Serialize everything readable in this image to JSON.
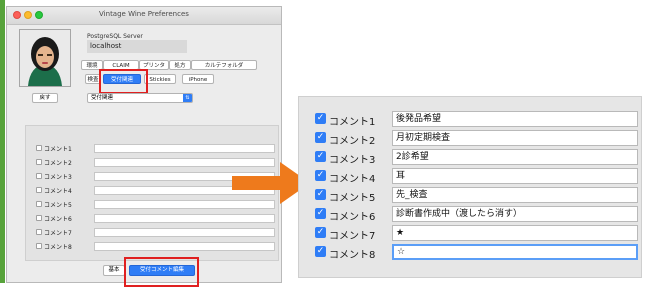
{
  "window": {
    "title": "Vintage Wine Preferences"
  },
  "server": {
    "label": "PostgreSQL Server",
    "value": "localhost"
  },
  "tabs_row1": [
    {
      "label": "環境"
    },
    {
      "label": "CLAIM"
    },
    {
      "label": "プリンタ"
    },
    {
      "label": "処方"
    },
    {
      "label": "カルテフォルダ"
    }
  ],
  "tabs_row2": [
    {
      "label": "検査"
    },
    {
      "label": "受付関連"
    },
    {
      "label": "Stickies"
    },
    {
      "label": "iPhone"
    }
  ],
  "selected_tab": "受付関連",
  "back_button": {
    "label": "戻す"
  },
  "section_select": {
    "value": "受付関連"
  },
  "small_comments": [
    {
      "label": "コメント1",
      "checked": false
    },
    {
      "label": "コメント2",
      "checked": false
    },
    {
      "label": "コメント3",
      "checked": false
    },
    {
      "label": "コメント4",
      "checked": false
    },
    {
      "label": "コメント5",
      "checked": false
    },
    {
      "label": "コメント6",
      "checked": false
    },
    {
      "label": "コメント7",
      "checked": false
    },
    {
      "label": "コメント8",
      "checked": false
    }
  ],
  "bottom_buttons": [
    {
      "label": "基本",
      "selected": false
    },
    {
      "label": "受付コメント編集",
      "selected": true
    }
  ],
  "zoom_comments": [
    {
      "label": "コメント1",
      "checked": true,
      "value": "後発品希望"
    },
    {
      "label": "コメント2",
      "checked": true,
      "value": "月初定期検査"
    },
    {
      "label": "コメント3",
      "checked": true,
      "value": "2診希望"
    },
    {
      "label": "コメント4",
      "checked": true,
      "value": "耳"
    },
    {
      "label": "コメント5",
      "checked": true,
      "value": "先_検査"
    },
    {
      "label": "コメント6",
      "checked": true,
      "value": "診断書作成中（渡したら消す）"
    },
    {
      "label": "コメント7",
      "checked": true,
      "value": "★"
    },
    {
      "label": "コメント8",
      "checked": true,
      "value": "☆",
      "focused": true
    }
  ],
  "colors": {
    "accent": "#2f7df6",
    "highlight_box": "#e02020",
    "arrow": "#ee7a1c",
    "window_strip": "#57a33b"
  },
  "icons": {
    "checkbox_checked": "checkmark-icon",
    "select_chevron": "chevron-updown-icon",
    "arrow": "right-arrow-icon"
  }
}
